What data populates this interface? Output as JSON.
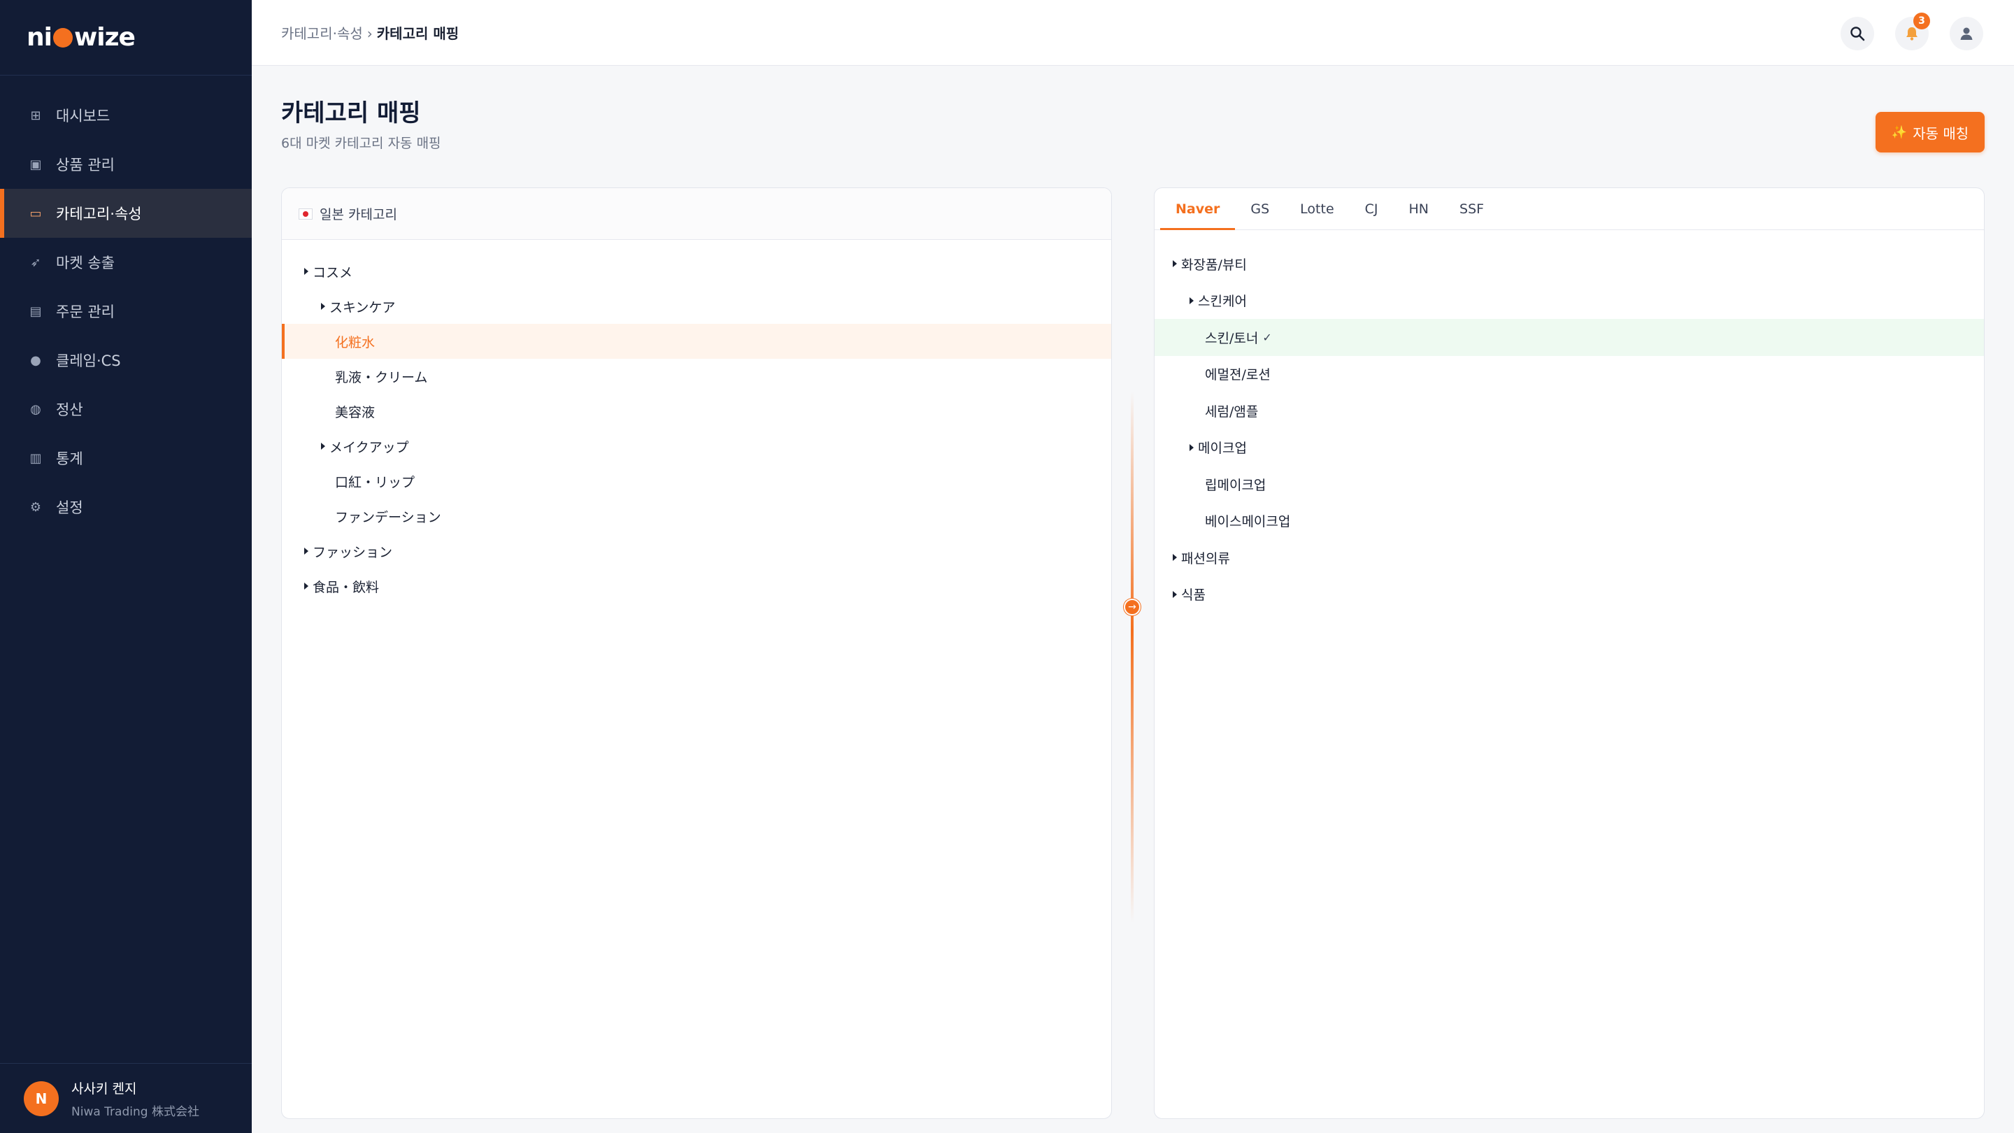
{
  "brand": {
    "logo_prefix": "ni",
    "logo_suffix": "wize",
    "accent": "#f4701f",
    "sidebar_bg": "#121c35"
  },
  "sidebar": {
    "items": [
      {
        "label": "대시보드",
        "icon": "grid-icon"
      },
      {
        "label": "상품 관리",
        "icon": "box-icon"
      },
      {
        "label": "카테고리·속성",
        "icon": "tag-icon",
        "active": true
      },
      {
        "label": "마켓 송출",
        "icon": "rocket-icon"
      },
      {
        "label": "주문 관리",
        "icon": "clipboard-icon"
      },
      {
        "label": "클레임·CS",
        "icon": "chat-icon"
      },
      {
        "label": "정산",
        "icon": "money-bag-icon"
      },
      {
        "label": "통계",
        "icon": "bar-chart-icon"
      },
      {
        "label": "설정",
        "icon": "gear-icon"
      }
    ],
    "user": {
      "initial": "N",
      "name": "사사키 켄지",
      "company": "Niwa Trading 株式会社"
    }
  },
  "header": {
    "breadcrumb": {
      "parent": "카테고리·속성",
      "separator": "›",
      "current": "카테고리 매핑"
    },
    "notification_count": "3"
  },
  "page": {
    "title": "카테고리 매핑",
    "subtitle": "6대 마켓 카테고리 자동 매핑",
    "auto_button": "자동 매칭"
  },
  "left_panel": {
    "title": "일본 카테고리",
    "tree": [
      {
        "label": "コスメ",
        "level": 0,
        "expandable": true
      },
      {
        "label": "スキンケア",
        "level": 1,
        "expandable": true
      },
      {
        "label": "化粧水",
        "level": 2,
        "selected": true
      },
      {
        "label": "乳液・クリーム",
        "level": 2
      },
      {
        "label": "美容液",
        "level": 2
      },
      {
        "label": "メイクアップ",
        "level": 1,
        "expandable": true
      },
      {
        "label": "口紅・リップ",
        "level": 2
      },
      {
        "label": "ファンデーション",
        "level": 2
      },
      {
        "label": "ファッション",
        "level": 0,
        "expandable": true
      },
      {
        "label": "食品・飲料",
        "level": 0,
        "expandable": true
      }
    ]
  },
  "right_panel": {
    "tabs": [
      {
        "label": "Naver",
        "active": true
      },
      {
        "label": "GS"
      },
      {
        "label": "Lotte"
      },
      {
        "label": "CJ"
      },
      {
        "label": "HN"
      },
      {
        "label": "SSF"
      }
    ],
    "tree": [
      {
        "label": "화장품/뷰티",
        "level": 0,
        "expandable": true
      },
      {
        "label": "스킨케어",
        "level": 1,
        "expandable": true
      },
      {
        "label": "스킨/토너",
        "level": 2,
        "selected": true,
        "check": "✓"
      },
      {
        "label": "에멀젼/로션",
        "level": 2
      },
      {
        "label": "세럼/앰플",
        "level": 2
      },
      {
        "label": "메이크업",
        "level": 1,
        "expandable": true
      },
      {
        "label": "립메이크업",
        "level": 2
      },
      {
        "label": "베이스메이크업",
        "level": 2
      },
      {
        "label": "패션의류",
        "level": 0,
        "expandable": true
      },
      {
        "label": "식품",
        "level": 0,
        "expandable": true
      }
    ]
  }
}
